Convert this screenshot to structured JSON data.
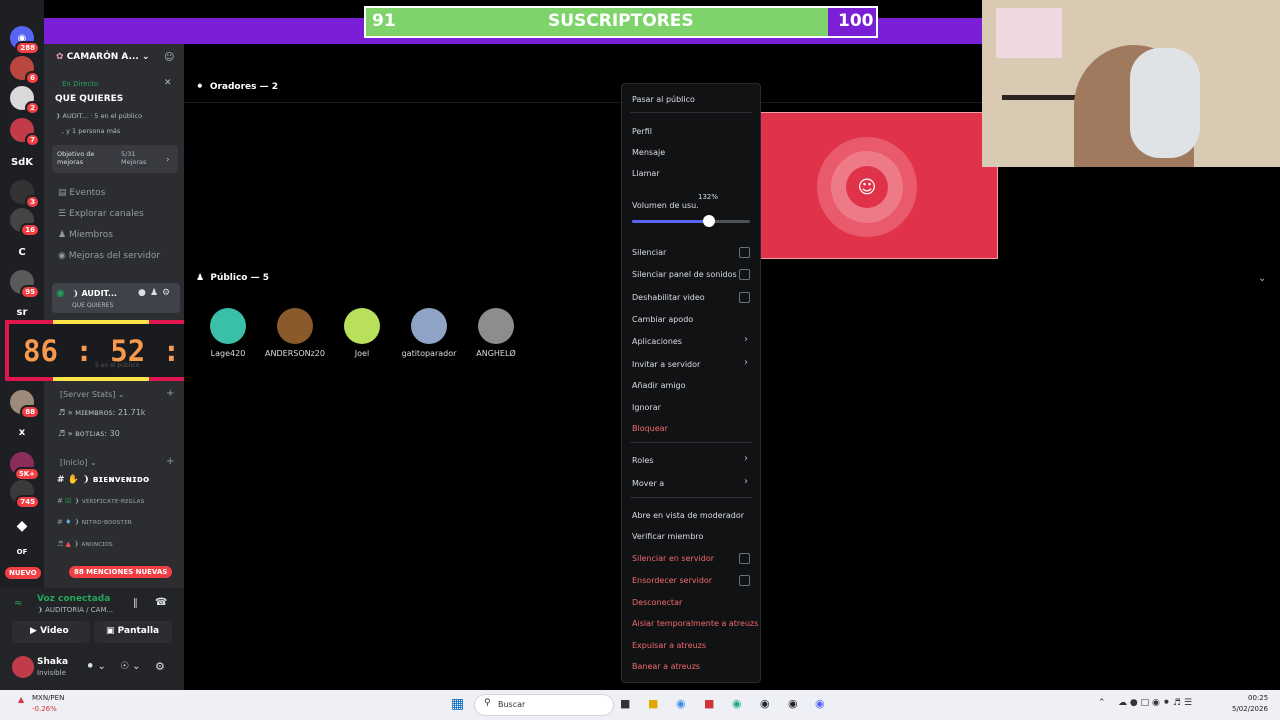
{
  "subs": {
    "current": "91",
    "label": "SUSCRIPTORES",
    "goal": "100",
    "progress": 0.91
  },
  "rail": {
    "badges": [
      "288",
      "6",
      "2",
      "7",
      "3",
      "16",
      "95",
      "88",
      "5K+",
      "745"
    ],
    "texts": [
      "SdK",
      "C",
      "sr",
      "x",
      "OF"
    ],
    "new_label": "NUEVO"
  },
  "server": {
    "name": "CAMARÓN A...",
    "live": "En Directo",
    "stage_topic": "QUE QUIERES",
    "stage_info": "❩ AUDIT...",
    "stage_listeners": "5 en el público",
    "stage_more": ", y 1 persona más",
    "goal_label": "Objetivo de mejoras",
    "goal_value": "5/31 Mejoras"
  },
  "nav": [
    "Eventos",
    "Explorar canales",
    "Miembros",
    "Mejoras del servidor"
  ],
  "voice_channel": {
    "name": "❩ AUDIT...",
    "sub": "QUE QUIERES"
  },
  "timer": "86 : 52 : 51",
  "timer_hidden_text": "5 en el público",
  "stats": {
    "category": "Server Stats",
    "members": "ᴍɪᴇᴍʙʀᴏs: 21.71k",
    "bots": "ʙᴏᴛɪᴊᴀs: 30"
  },
  "inicio": {
    "category": "Inicio",
    "channels": [
      "❩ ʙɪᴇɴᴠᴇɴɪᴅᴏ",
      "❩ ᴠᴇʀɪғɪᴄᴀᴛᴇ-ʀᴇɢʟᴀs",
      "❩ ɴɪᴛʀᴏ-ʙᴏᴏsᴛᴇʀ",
      "❩ ᴀɴᴜɴᴄɪᴏs"
    ],
    "mentions": "88 MENCIONES NUEVAS"
  },
  "voice": {
    "status": "Voz conectada",
    "channel": "❩ AUDITORIA / CAM...",
    "video": "Video",
    "screen": "Pantalla"
  },
  "user": {
    "name": "Shaka",
    "status": "Invisible"
  },
  "stage": {
    "speakers": "Oradores — 2",
    "audience": "Público — 5",
    "listeners": [
      {
        "name": "Lage420",
        "color": "#3ac0a6"
      },
      {
        "name": "ANDERSONz20",
        "color": "#8a5a2a"
      },
      {
        "name": "Joel",
        "color": "#b8e05a"
      },
      {
        "name": "gatitoparador",
        "color": "#8fa3c7"
      },
      {
        "name": "ANGHELØ",
        "color": "#8d8d8d"
      }
    ]
  },
  "menu": {
    "items": [
      "Pasar al público",
      "Perfil",
      "Mensaje",
      "Llamar",
      "Volumen de usu.",
      "Silenciar",
      "Silenciar panel de sonidos",
      "Deshabilitar video",
      "Cambiar apodo",
      "Aplicaciones",
      "Invitar a servidor",
      "Añadir amigo",
      "Ignorar",
      "Bloquear",
      "Roles",
      "Mover a",
      "Abre en vista de moderador",
      "Verificar miembro",
      "Silenciar en servidor",
      "Ensordecer servidor",
      "Desconectar",
      "Aislar temporalmente a atreuzs",
      "Expulsar a atreuzs",
      "Banear a atreuzs"
    ],
    "volume_label": "132%",
    "volume_fraction": 0.38
  },
  "taskbar": {
    "stock": "MXN/PEN",
    "stock_change": "-0.26%",
    "search": "Buscar",
    "time": "00:25",
    "date": "5/02/2026"
  },
  "colors": {
    "accent": "#5865f2",
    "danger": "#f26a6d",
    "purple": "#7a1fd6",
    "green": "#7ed36a"
  }
}
